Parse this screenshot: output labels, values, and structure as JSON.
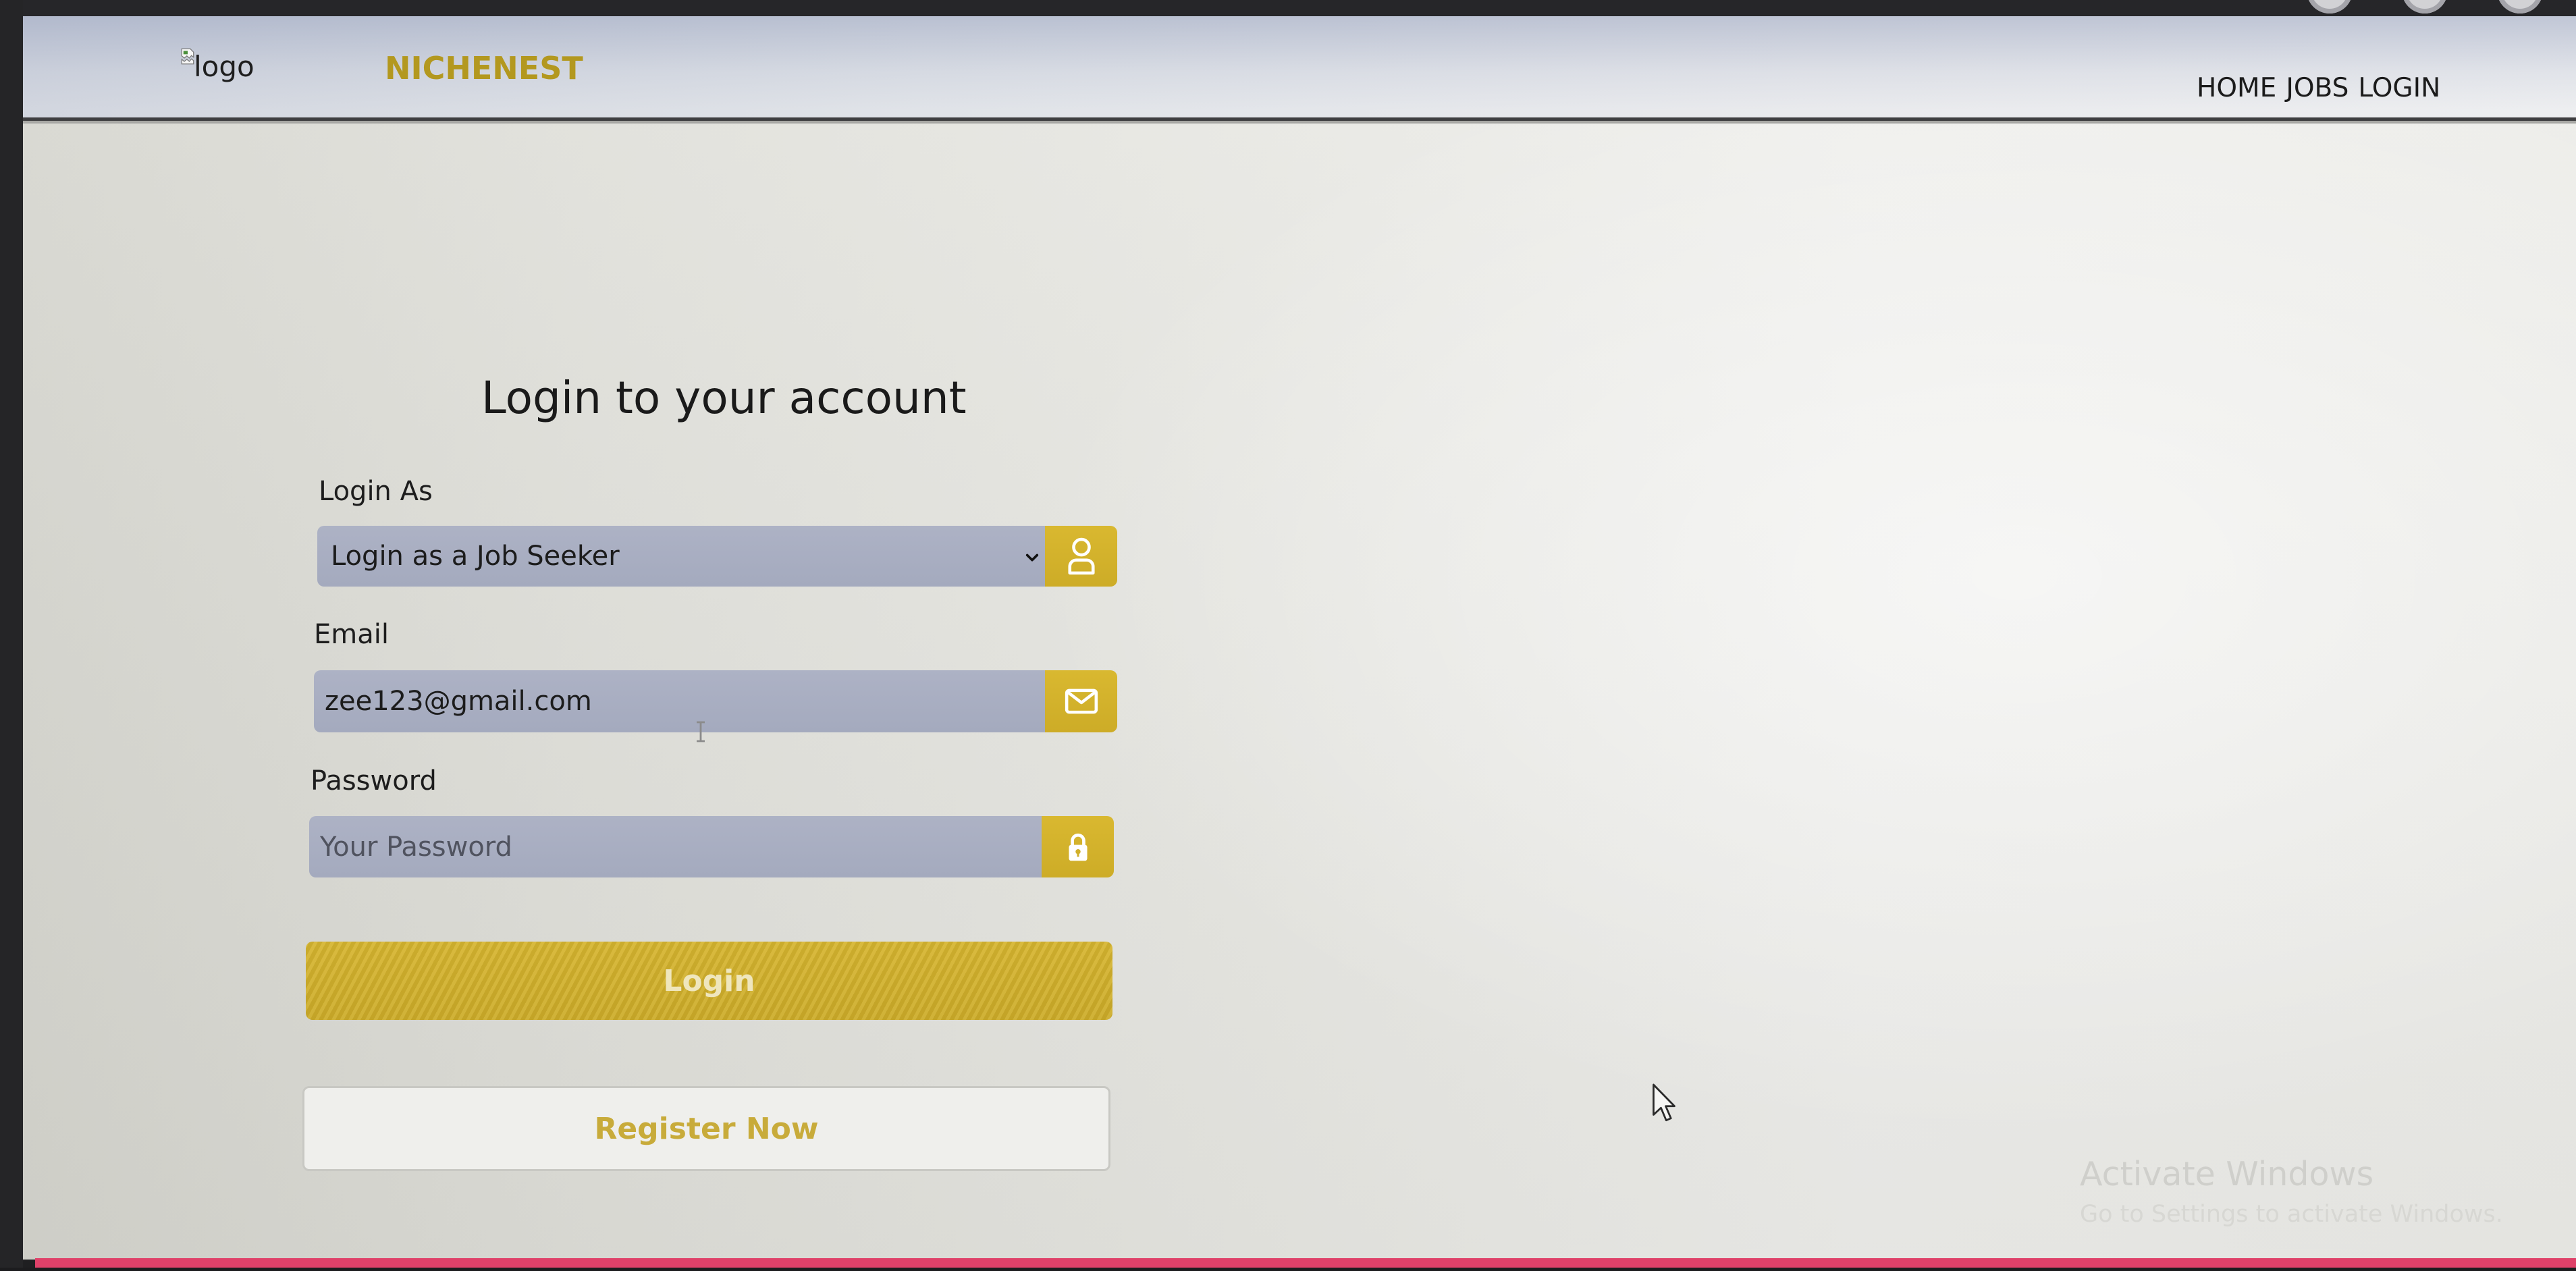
{
  "header": {
    "logo_alt": "logo",
    "brand": "NICHENEST",
    "nav": [
      {
        "label": "HOME"
      },
      {
        "label": "JOBS"
      },
      {
        "label": "LOGIN"
      }
    ]
  },
  "login_form": {
    "title": "Login to your account",
    "login_as": {
      "label": "Login As",
      "selected": "Login as a Job Seeker",
      "icon": "user-icon",
      "dropdown_icon": "chevron-down-icon"
    },
    "email": {
      "label": "Email",
      "value": "zee123@gmail.com",
      "icon": "envelope-icon"
    },
    "password": {
      "label": "Password",
      "placeholder": "Your Password",
      "icon": "lock-icon"
    },
    "login_button": "Login",
    "register_button": "Register Now"
  },
  "windows_watermark": {
    "title": "Activate Windows",
    "subtitle": "Go to Settings to activate Windows."
  },
  "colors": {
    "accent_gold": "#d3b22c",
    "brand_text": "#b3981f",
    "input_background": "#a8aec2",
    "register_text": "#c8ab3a",
    "footer_line": "#df4169",
    "header_border": "#3e3e40"
  }
}
